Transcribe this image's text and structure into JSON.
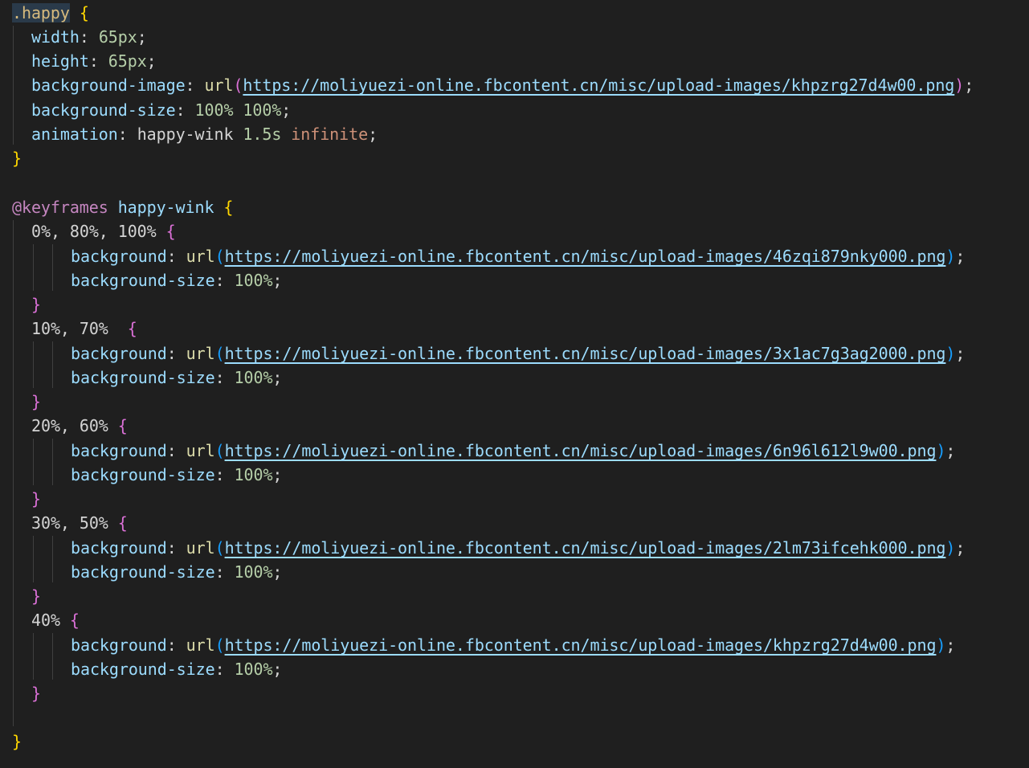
{
  "editor": {
    "theme_colors": {
      "background": "#1f1f1f",
      "selector": "#d7ba7d",
      "property": "#9cdcfe",
      "number": "#b5cea8",
      "keyword": "#ce9178",
      "function": "#dcdcaa",
      "at_rule": "#c586c0",
      "bracket_level1": "#ffd700",
      "bracket_level2": "#da70d6",
      "bracket_level3": "#179fff"
    },
    "lines": {
      "selector": ".happy",
      "width_prop": "width",
      "width_val": "65px",
      "height_prop": "height",
      "height_val": "65px",
      "bgimage_prop": "background-image",
      "url_fn": "url",
      "url_main": "https://moliyuezi-online.fbcontent.cn/misc/upload-images/khpzrg27d4w00.png",
      "bgsize_prop": "background-size",
      "bgsize_val1": "100%",
      "bgsize_val2": "100%",
      "anim_prop": "animation",
      "anim_name": "happy-wink",
      "anim_dur": "1.5s",
      "anim_iter": "infinite",
      "keyframes_kw": "@keyframes",
      "keyframes_name": "happy-wink",
      "bg_prop": "background",
      "bgsize_single": "100%"
    },
    "keyframes": [
      {
        "selector": "0%, 80%, 100%",
        "url": "https://moliyuezi-online.fbcontent.cn/misc/upload-images/46zqi879nky000.png"
      },
      {
        "selector": "10%, 70% ",
        "url": "https://moliyuezi-online.fbcontent.cn/misc/upload-images/3x1ac7g3ag2000.png"
      },
      {
        "selector": "20%, 60%",
        "url": "https://moliyuezi-online.fbcontent.cn/misc/upload-images/6n96l612l9w00.png"
      },
      {
        "selector": "30%, 50%",
        "url": "https://moliyuezi-online.fbcontent.cn/misc/upload-images/2lm73ifcehk000.png"
      },
      {
        "selector": "40%",
        "url": "https://moliyuezi-online.fbcontent.cn/misc/upload-images/khpzrg27d4w00.png"
      }
    ]
  }
}
